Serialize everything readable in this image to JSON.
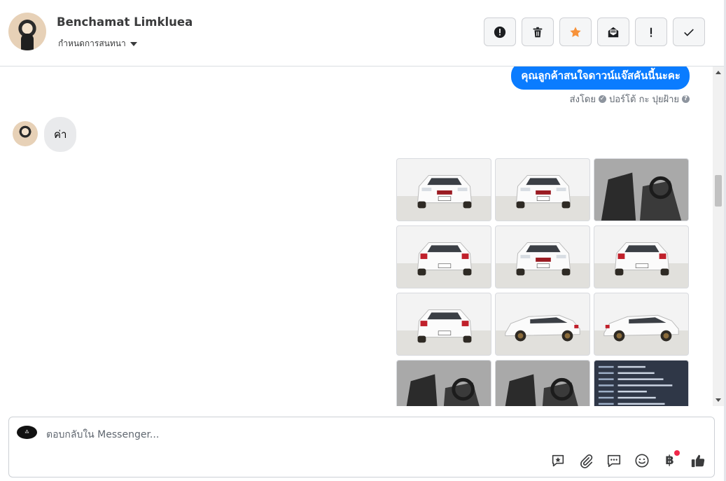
{
  "header": {
    "contact_name": "Benchamat Limkluea",
    "assign_label": "กำหนดการสนทนา",
    "actions": [
      {
        "name": "spam",
        "icon": "alert-circle-icon"
      },
      {
        "name": "delete",
        "icon": "trash-icon"
      },
      {
        "name": "star",
        "icon": "star-icon",
        "color": "#f7923a"
      },
      {
        "name": "mark-unread",
        "icon": "mail-open-icon"
      },
      {
        "name": "follow-up",
        "icon": "exclamation-icon"
      },
      {
        "name": "done",
        "icon": "check-icon"
      }
    ]
  },
  "conversation": {
    "outgoing_message": "คุณลูกค้าสนใจดาวน์แจ๊สคันนี้นะคะ",
    "sent_by_prefix": "ส่งโดย",
    "sent_by_name": "ปอร์โต้ กะ ปุยฝ้าย",
    "incoming_message": "ค่า",
    "photos": [
      {
        "kind": "exterior",
        "view": "front-left"
      },
      {
        "kind": "exterior",
        "view": "front"
      },
      {
        "kind": "interior",
        "view": "driver-seat"
      },
      {
        "kind": "exterior",
        "view": "rear-left"
      },
      {
        "kind": "exterior",
        "view": "front-right"
      },
      {
        "kind": "exterior",
        "view": "rear"
      },
      {
        "kind": "exterior",
        "view": "rear-left-2"
      },
      {
        "kind": "exterior",
        "view": "side-left"
      },
      {
        "kind": "exterior",
        "view": "side-right"
      },
      {
        "kind": "interior",
        "view": "rear-seat"
      },
      {
        "kind": "interior",
        "view": "dashboard"
      },
      {
        "kind": "spec",
        "view": "spec-sheet"
      }
    ]
  },
  "composer": {
    "placeholder": "ตอบกลับใน Messenger...",
    "tools": [
      "saved-reply-icon",
      "attachment-icon",
      "chat-icon",
      "emoji-icon",
      "baht-icon",
      "like-icon"
    ]
  },
  "colors": {
    "accent": "#0a7cff",
    "star": "#f7923a",
    "notification": "#f02849"
  }
}
